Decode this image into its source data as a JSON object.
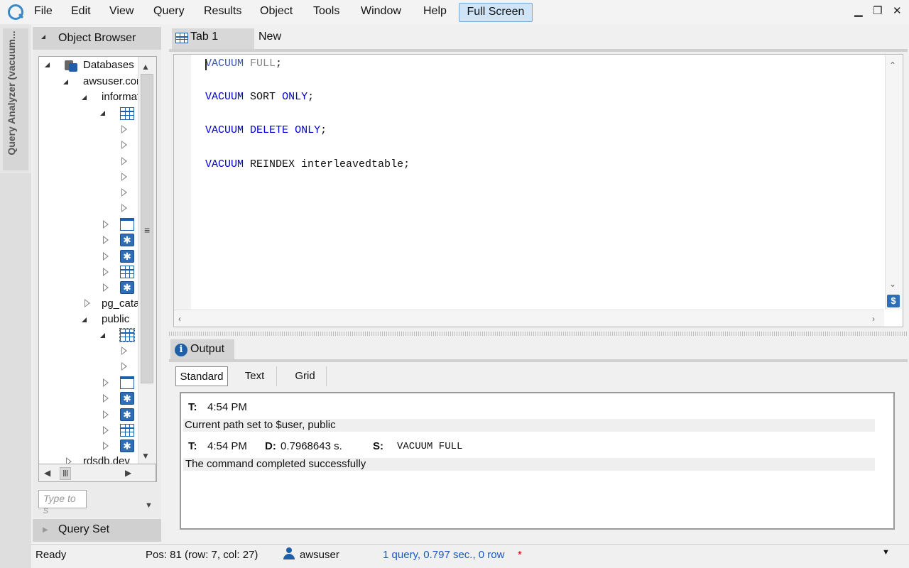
{
  "menu": {
    "items": [
      "File",
      "Edit",
      "View",
      "Query",
      "Results",
      "Object",
      "Tools",
      "Window",
      "Help"
    ],
    "full_screen": "Full Screen"
  },
  "side_panel": {
    "label": "Query Analyzer (vacuum..."
  },
  "object_browser": {
    "title": "Object Browser",
    "tree": {
      "databases": "Databases",
      "connection": "awsuser.cor",
      "schema_information": "informat",
      "schema_pg_catalog": "pg_cata",
      "schema_public": "public",
      "database_rds": "rdsdb.dev"
    },
    "filter_placeholder": "Type to s"
  },
  "query_set": {
    "title": "Query Set"
  },
  "editor": {
    "tabs": [
      "Tab 1",
      "New"
    ],
    "lines": [
      {
        "kw": "VACUUM",
        "kw2": "FULL",
        "rest": ";"
      },
      {
        "kw": "VACUUM",
        "mid": "SORT",
        "kw2": "ONLY",
        "rest": ";"
      },
      {
        "kw": "VACUUM",
        "mid": "DELETE",
        "kw2": "ONLY",
        "rest": ";"
      },
      {
        "kw": "VACUUM",
        "mid": "REINDEX interleavedtable",
        "rest": ";"
      }
    ]
  },
  "output": {
    "tab": "Output",
    "subtabs": [
      "Standard",
      "Text",
      "Grid"
    ],
    "entries": [
      {
        "t_label": "T:",
        "time": "4:54 PM",
        "message": "Current path set to $user, public"
      },
      {
        "t_label": "T:",
        "time": "4:54 PM",
        "d_label": "D:",
        "duration": "0.7968643 s.",
        "s_label": "S:",
        "statement": "VACUUM FULL",
        "message": "The command completed successfully"
      }
    ]
  },
  "status": {
    "state": "Ready",
    "position": "Pos: 81 (row: 7, col: 27)",
    "user": "awsuser",
    "summary": "1 query, 0.797 sec., 0 row",
    "modified_marker": "*"
  },
  "colors": {
    "keyword": "#0000d0",
    "accent": "#1f5fa8",
    "summary": "#1a56c8",
    "modified": "#d00000"
  }
}
